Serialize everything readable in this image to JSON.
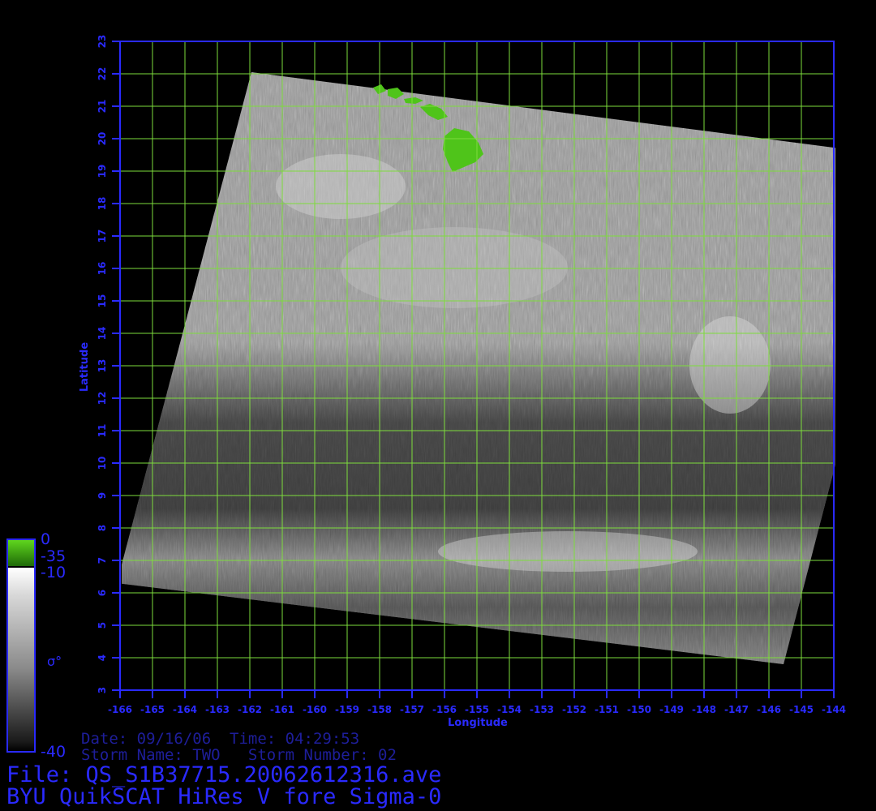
{
  "map": {
    "x_axis_label": "Longitude",
    "y_axis_label": "Latitude",
    "lon_ticks": [
      "-166",
      "-165",
      "-164",
      "-163",
      "-162",
      "-161",
      "-160",
      "-159",
      "-158",
      "-157",
      "-156",
      "-155",
      "-154",
      "-153",
      "-152",
      "-151",
      "-150",
      "-149",
      "-148",
      "-147",
      "-146",
      "-145",
      "-144"
    ],
    "lat_ticks": [
      "3",
      "4",
      "5",
      "6",
      "7",
      "8",
      "9",
      "10",
      "11",
      "12",
      "13",
      "14",
      "15",
      "16",
      "17",
      "18",
      "19",
      "20",
      "21",
      "22",
      "23"
    ],
    "lon_range": [
      -166,
      -144
    ],
    "lat_range": [
      3,
      23
    ],
    "grid": true,
    "colors": {
      "axis": "#2a2aff",
      "grid": "#7ddc3c",
      "land": "#4fc41a",
      "background": "#000000"
    },
    "swath_corners_deg": [
      [
        -161.95,
        22.05
      ],
      [
        -141.5,
        19.4
      ],
      [
        -145.55,
        3.8
      ],
      [
        -166.1,
        6.3
      ]
    ],
    "land_features": [
      "hawaii-big-island",
      "maui",
      "molokai",
      "oahu",
      "kauai"
    ]
  },
  "colorbar": {
    "top_label": "0",
    "land_label": "-35",
    "upper_label": "-10",
    "symbol": "σ°",
    "bottom_label": "-40"
  },
  "info": {
    "line1": "Date: 09/16/06  Time: 04:29:53",
    "line2": "Storm Name: TWO   Storm Number: 02",
    "file": "File: QS_S1B37715.20062612316.ave",
    "title": "BYU QuikSCAT HiRes V fore Sigma-0"
  }
}
